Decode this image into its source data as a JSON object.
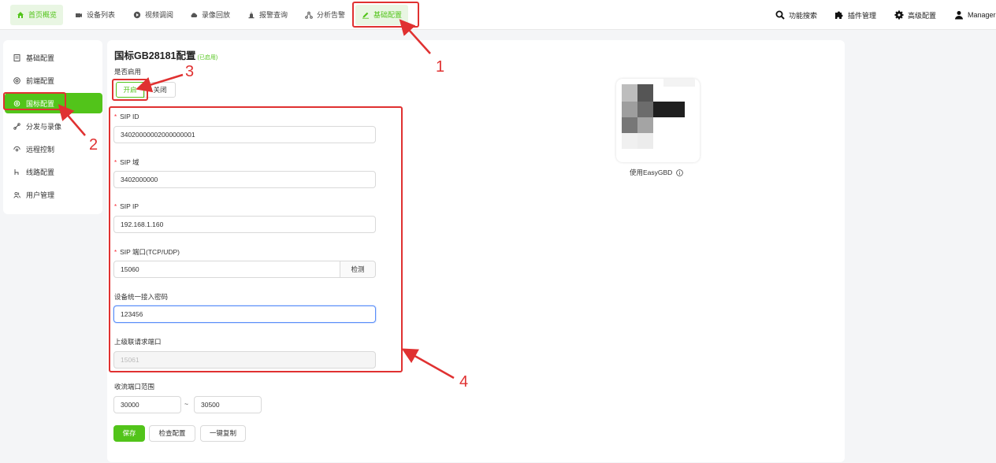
{
  "topnav": {
    "items": [
      {
        "label": "首页概览",
        "icon": "home-icon"
      },
      {
        "label": "设备列表",
        "icon": "camera-icon"
      },
      {
        "label": "视频调阅",
        "icon": "play-icon"
      },
      {
        "label": "录像回放",
        "icon": "cloud-icon"
      },
      {
        "label": "报警查询",
        "icon": "alarm-icon"
      },
      {
        "label": "分析告警",
        "icon": "analysis-icon"
      },
      {
        "label": "基础配置",
        "icon": "edit-icon"
      }
    ],
    "right": [
      {
        "label": "功能搜索",
        "icon": "search-icon"
      },
      {
        "label": "插件管理",
        "icon": "puzzle-icon"
      },
      {
        "label": "高级配置",
        "icon": "gear-icon"
      },
      {
        "label": "Manager",
        "icon": "user-icon"
      }
    ]
  },
  "sidebar": {
    "items": [
      {
        "label": "基础配置"
      },
      {
        "label": "前端配置"
      },
      {
        "label": "国标配置"
      },
      {
        "label": "分发与录像"
      },
      {
        "label": "远程控制"
      },
      {
        "label": "线路配置"
      },
      {
        "label": "用户管理"
      }
    ]
  },
  "form": {
    "title": "国标GB28181配置",
    "status": "(已启用)",
    "enable_label": "是否启用",
    "on_label": "开启",
    "off_label": "关闭",
    "sip_id_label": "SIP ID",
    "sip_id_value": "34020000002000000001",
    "sip_domain_label": "SIP 域",
    "sip_domain_value": "3402000000",
    "sip_ip_label": "SIP IP",
    "sip_ip_value": "192.168.1.160",
    "sip_port_label": "SIP 端口(TCP/UDP)",
    "sip_port_value": "15060",
    "check_label": "检测",
    "password_label": "设备统一接入密码",
    "password_value": "123456",
    "cascade_port_label": "上级联请求端口",
    "cascade_port_value": "15061",
    "stream_range_label": "收流端口范围",
    "range_from": "30000",
    "range_sep": "~",
    "range_to": "30500",
    "save_label": "保存",
    "check_config_label": "检查配置",
    "copy_label": "一键复制"
  },
  "qr": {
    "caption": "使用EasyGBD"
  },
  "annotations": {
    "n1": "1",
    "n2": "2",
    "n3": "3",
    "n4": "4"
  },
  "colors": {
    "accent": "#52c41a",
    "annotation": "#e03131"
  }
}
